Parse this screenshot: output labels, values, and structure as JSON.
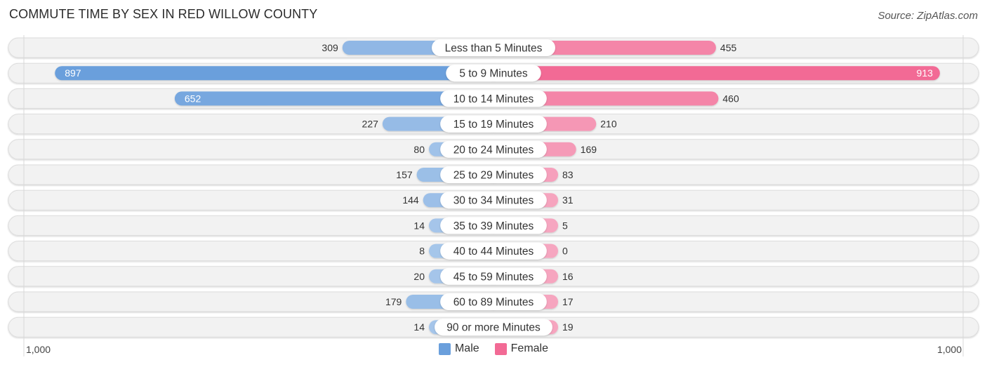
{
  "header": {
    "title": "COMMUTE TIME BY SEX IN RED WILLOW COUNTY",
    "source": "Source: ZipAtlas.com"
  },
  "colors": {
    "male": "#6a9fdc",
    "male_light": "#a6c6ea",
    "female": "#f26a95",
    "female_light": "#f6a6c0",
    "track": "#f2f2f2",
    "track_border": "#dddddd"
  },
  "legend": {
    "male_label": "Male",
    "female_label": "Female"
  },
  "axis": {
    "left_label": "1,000",
    "right_label": "1,000"
  },
  "chart_data": {
    "type": "bar",
    "orientation": "horizontal-diverging",
    "title": "COMMUTE TIME BY SEX IN RED WILLOW COUNTY",
    "xlabel": "",
    "ylabel": "",
    "xlim": [
      -1000,
      1000
    ],
    "legend_position": "bottom-center",
    "grid": false,
    "categories": [
      "Less than 5 Minutes",
      "5 to 9 Minutes",
      "10 to 14 Minutes",
      "15 to 19 Minutes",
      "20 to 24 Minutes",
      "25 to 29 Minutes",
      "30 to 34 Minutes",
      "35 to 39 Minutes",
      "40 to 44 Minutes",
      "45 to 59 Minutes",
      "60 to 89 Minutes",
      "90 or more Minutes"
    ],
    "series": [
      {
        "name": "Male",
        "values": [
          309,
          897,
          652,
          227,
          80,
          157,
          144,
          14,
          8,
          20,
          179,
          14
        ]
      },
      {
        "name": "Female",
        "values": [
          455,
          913,
          460,
          210,
          169,
          83,
          31,
          5,
          0,
          16,
          17,
          19
        ]
      }
    ],
    "tick_labels": [
      "1,000",
      "1,000"
    ]
  }
}
